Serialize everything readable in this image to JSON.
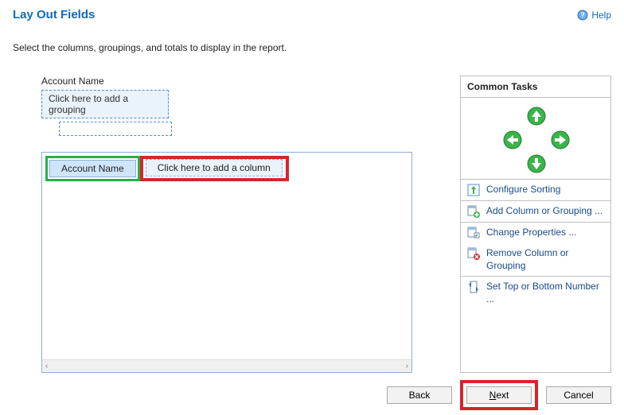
{
  "header": {
    "title": "Lay Out Fields",
    "help_label": "Help"
  },
  "instructions": "Select the columns, groupings, and totals to display in the report.",
  "grouping": {
    "label": "Account Name",
    "placeholder": "Click here to add a grouping"
  },
  "report": {
    "selected_column": "Account Name",
    "add_column_placeholder": "Click here to add a column"
  },
  "common_tasks": {
    "title": "Common Tasks",
    "configure_sorting": "Configure Sorting",
    "add_column": "Add Column or Grouping ...",
    "change_properties": "Change Properties ...",
    "remove": "Remove Column or Grouping",
    "set_top_bottom": "Set Top or Bottom Number ..."
  },
  "footer": {
    "back": "Back",
    "next_prefix": "N",
    "next_rest": "ext",
    "cancel": "Cancel"
  }
}
